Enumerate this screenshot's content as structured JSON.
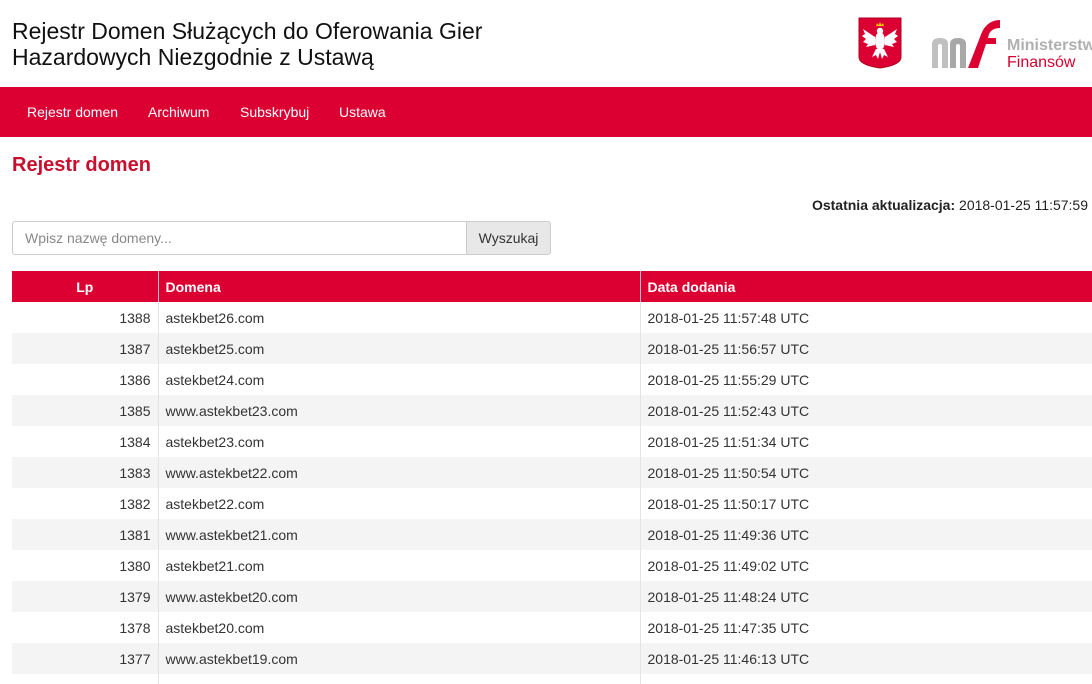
{
  "header": {
    "title_line1": "Rejestr Domen Służących do Oferowania Gier",
    "title_line2": "Hazardowych Niezgodnie z Ustawą",
    "ministry_line1": "Ministerstwo",
    "ministry_line2": "Finansów",
    "emblem_icon": "polish-eagle-emblem-icon",
    "logo_icon": "mf-logo-icon"
  },
  "colors": {
    "brand_red": "#dc0032",
    "title_red": "#c8102e"
  },
  "nav": {
    "items": [
      {
        "label": "Rejestr domen"
      },
      {
        "label": "Archiwum"
      },
      {
        "label": "Subskrybuj"
      },
      {
        "label": "Ustawa"
      }
    ]
  },
  "main": {
    "page_title": "Rejestr domen",
    "last_update_label": "Ostatnia aktualizacja:",
    "last_update_value": "2018-01-25 11:57:59"
  },
  "search": {
    "placeholder": "Wpisz nazwę domeny...",
    "value": "",
    "button_label": "Wyszukaj"
  },
  "table": {
    "headers": {
      "lp": "Lp",
      "domain": "Domena",
      "date": "Data dodania"
    },
    "rows": [
      {
        "lp": "1388",
        "domain": "astekbet26.com",
        "date": "2018-01-25 11:57:48 UTC"
      },
      {
        "lp": "1387",
        "domain": "astekbet25.com",
        "date": "2018-01-25 11:56:57 UTC"
      },
      {
        "lp": "1386",
        "domain": "astekbet24.com",
        "date": "2018-01-25 11:55:29 UTC"
      },
      {
        "lp": "1385",
        "domain": "www.astekbet23.com",
        "date": "2018-01-25 11:52:43 UTC"
      },
      {
        "lp": "1384",
        "domain": "astekbet23.com",
        "date": "2018-01-25 11:51:34 UTC"
      },
      {
        "lp": "1383",
        "domain": "www.astekbet22.com",
        "date": "2018-01-25 11:50:54 UTC"
      },
      {
        "lp": "1382",
        "domain": "astekbet22.com",
        "date": "2018-01-25 11:50:17 UTC"
      },
      {
        "lp": "1381",
        "domain": "www.astekbet21.com",
        "date": "2018-01-25 11:49:36 UTC"
      },
      {
        "lp": "1380",
        "domain": "astekbet21.com",
        "date": "2018-01-25 11:49:02 UTC"
      },
      {
        "lp": "1379",
        "domain": "www.astekbet20.com",
        "date": "2018-01-25 11:48:24 UTC"
      },
      {
        "lp": "1378",
        "domain": "astekbet20.com",
        "date": "2018-01-25 11:47:35 UTC"
      },
      {
        "lp": "1377",
        "domain": "www.astekbet19.com",
        "date": "2018-01-25 11:46:13 UTC"
      },
      {
        "lp": "",
        "domain": "",
        "date": ""
      }
    ]
  }
}
